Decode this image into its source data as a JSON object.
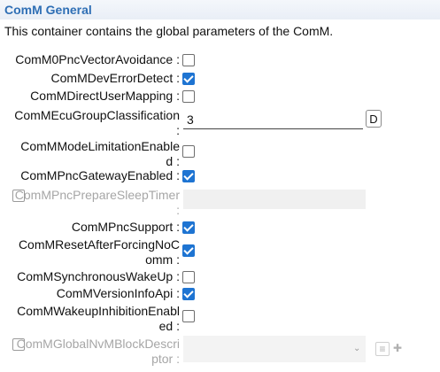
{
  "header": {
    "title": "ComM General"
  },
  "description": "This container contains the global parameters of the ComM.",
  "params": {
    "p0": {
      "label": "ComM0PncVectorAvoidance :",
      "checked": false
    },
    "p1": {
      "label": "ComMDevErrorDetect :",
      "checked": true
    },
    "p2": {
      "label": "ComMDirectUserMapping :",
      "checked": false
    },
    "p3": {
      "label": "ComMEcuGroupClassification\n:",
      "value": "3",
      "button": "D"
    },
    "p4": {
      "label": "ComMModeLimitationEnable\nd :",
      "checked": false
    },
    "p5": {
      "label": "ComMPncGatewayEnabled :",
      "checked": true
    },
    "p6": {
      "label": "ComMPncPrepareSleepTimer\n:",
      "enabled": false
    },
    "p7": {
      "label": "ComMPncSupport :",
      "checked": true
    },
    "p8": {
      "label": "ComMResetAfterForcingNoC\nomm :",
      "checked": true
    },
    "p9": {
      "label": "ComMSynchronousWakeUp :",
      "checked": false
    },
    "p10": {
      "label": "ComMVersionInfoApi :",
      "checked": true
    },
    "p11": {
      "label": "ComMWakeupInhibitionEnabl\ned :",
      "checked": false
    },
    "p12": {
      "label": "ComMGlobalNvMBlockDescri\nptor :",
      "enabled": false
    }
  },
  "icons": {
    "check": "checkmark-icon",
    "dropdown": "chevron-down-icon",
    "list": "list-icon",
    "add": "add-icon"
  },
  "colors": {
    "title": "#2f6fb5",
    "checkbox_checked": "#1e74d2",
    "disabled_text": "#a6a6a6"
  }
}
